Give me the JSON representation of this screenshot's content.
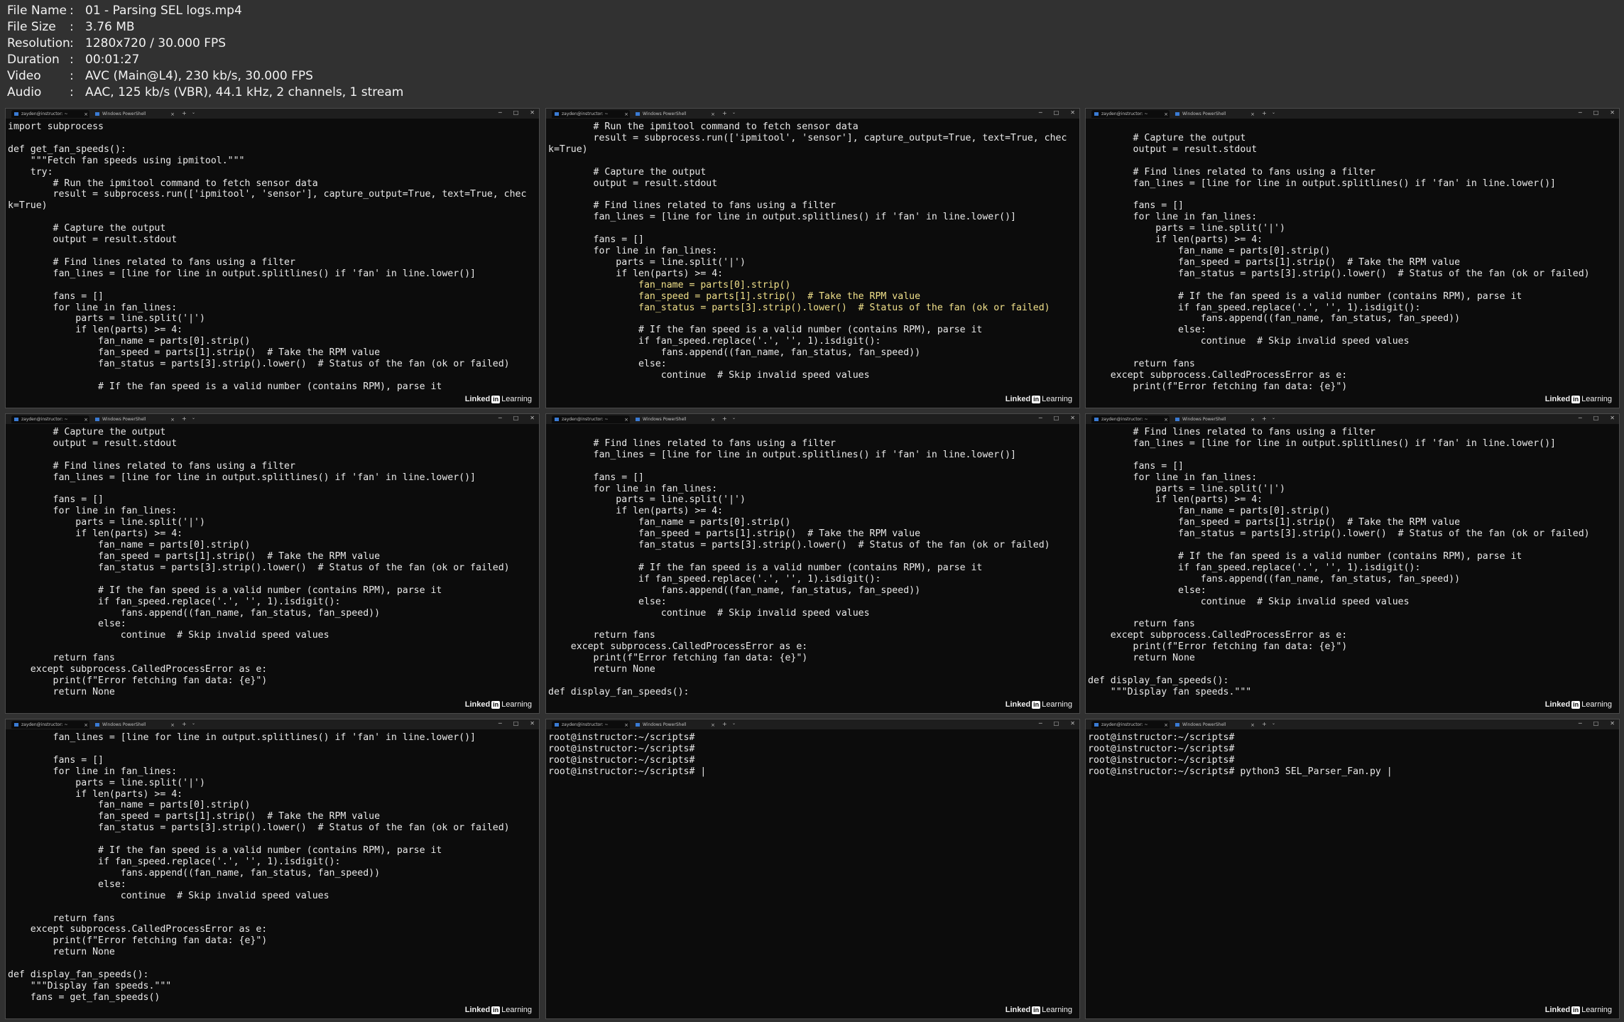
{
  "metadata": [
    {
      "key": "File Name",
      "value": "01 - Parsing SEL logs.mp4"
    },
    {
      "key": "File Size",
      "value": "3.76 MB"
    },
    {
      "key": "Resolution",
      "value": "1280x720 / 30.000 FPS"
    },
    {
      "key": "Duration",
      "value": "00:01:27"
    },
    {
      "key": "Video",
      "value": "AVC (Main@L4), 230 kb/s, 30.000 FPS"
    },
    {
      "key": "Audio",
      "value": "AAC, 125 kb/s (VBR), 44.1 kHz, 2 channels, 1 stream"
    }
  ],
  "terminal": {
    "tab1_label": "zayden@instructor: ~",
    "tab2_label": "Windows PowerShell",
    "close_glyph": "×",
    "new_tab_glyph": "+",
    "dropdown_glyph": "⌄",
    "minimize_glyph": "─",
    "maximize_glyph": "□",
    "window_close_glyph": "✕"
  },
  "watermark": {
    "text1": "Linked",
    "badge": "in",
    "text2": "Learning"
  },
  "frames": [
    {
      "lines": [
        "import subprocess",
        "",
        "def get_fan_speeds():",
        "    \"\"\"Fetch fan speeds using ipmitool.\"\"\"",
        "    try:",
        "        # Run the ipmitool command to fetch sensor data",
        "        result = subprocess.run(['ipmitool', 'sensor'], capture_output=True, text=True, chec",
        "k=True)",
        "",
        "        # Capture the output",
        "        output = result.stdout",
        "",
        "        # Find lines related to fans using a filter",
        "        fan_lines = [line for line in output.splitlines() if 'fan' in line.lower()]",
        "",
        "        fans = []",
        "        for line in fan_lines:",
        "            parts = line.split('|')",
        "            if len(parts) >= 4:",
        "                fan_name = parts[0].strip()",
        "                fan_speed = parts[1].strip()  # Take the RPM value",
        "                fan_status = parts[3].strip().lower()  # Status of the fan (ok or failed)",
        "",
        "                # If the fan speed is a valid number (contains RPM), parse it"
      ]
    },
    {
      "lines": [
        "        # Run the ipmitool command to fetch sensor data",
        "        result = subprocess.run(['ipmitool', 'sensor'], capture_output=True, text=True, chec",
        "k=True)",
        "",
        "        # Capture the output",
        "        output = result.stdout",
        "",
        "        # Find lines related to fans using a filter",
        "        fan_lines = [line for line in output.splitlines() if 'fan' in line.lower()]",
        "",
        "        fans = []",
        "        for line in fan_lines:",
        "            parts = line.split('|')",
        "            if len(parts) >= 4:",
        "                fan_name = parts[0].strip()",
        "                fan_speed = parts[1].strip()  # Take the RPM value",
        "                fan_status = parts[3].strip().lower()  # Status of the fan (ok or failed)",
        "",
        "                # If the fan speed is a valid number (contains RPM), parse it",
        "                if fan_speed.replace('.', '', 1).isdigit():",
        "                    fans.append((fan_name, fan_status, fan_speed))",
        "                else:",
        "                    continue  # Skip invalid speed values"
      ],
      "highlight": [
        14,
        15,
        16
      ]
    },
    {
      "lines": [
        "",
        "        # Capture the output",
        "        output = result.stdout",
        "",
        "        # Find lines related to fans using a filter",
        "        fan_lines = [line for line in output.splitlines() if 'fan' in line.lower()]",
        "",
        "        fans = []",
        "        for line in fan_lines:",
        "            parts = line.split('|')",
        "            if len(parts) >= 4:",
        "                fan_name = parts[0].strip()",
        "                fan_speed = parts[1].strip()  # Take the RPM value",
        "                fan_status = parts[3].strip().lower()  # Status of the fan (ok or failed)",
        "",
        "                # If the fan speed is a valid number (contains RPM), parse it",
        "                if fan_speed.replace('.', '', 1).isdigit():",
        "                    fans.append((fan_name, fan_status, fan_speed))",
        "                else:",
        "                    continue  # Skip invalid speed values",
        "",
        "        return fans",
        "    except subprocess.CalledProcessError as e:",
        "        print(f\"Error fetching fan data: {e}\")"
      ]
    },
    {
      "lines": [
        "        # Capture the output",
        "        output = result.stdout",
        "",
        "        # Find lines related to fans using a filter",
        "        fan_lines = [line for line in output.splitlines() if 'fan' in line.lower()]",
        "",
        "        fans = []",
        "        for line in fan_lines:",
        "            parts = line.split('|')",
        "            if len(parts) >= 4:",
        "                fan_name = parts[0].strip()",
        "                fan_speed = parts[1].strip()  # Take the RPM value",
        "                fan_status = parts[3].strip().lower()  # Status of the fan (ok or failed)",
        "",
        "                # If the fan speed is a valid number (contains RPM), parse it",
        "                if fan_speed.replace('.', '', 1).isdigit():",
        "                    fans.append((fan_name, fan_status, fan_speed))",
        "                else:",
        "                    continue  # Skip invalid speed values",
        "",
        "        return fans",
        "    except subprocess.CalledProcessError as e:",
        "        print(f\"Error fetching fan data: {e}\")",
        "        return None"
      ]
    },
    {
      "lines": [
        "",
        "        # Find lines related to fans using a filter",
        "        fan_lines = [line for line in output.splitlines() if 'fan' in line.lower()]",
        "",
        "        fans = []",
        "        for line in fan_lines:",
        "            parts = line.split('|')",
        "            if len(parts) >= 4:",
        "                fan_name = parts[0].strip()",
        "                fan_speed = parts[1].strip()  # Take the RPM value",
        "                fan_status = parts[3].strip().lower()  # Status of the fan (ok or failed)",
        "",
        "                # If the fan speed is a valid number (contains RPM), parse it",
        "                if fan_speed.replace('.', '', 1).isdigit():",
        "                    fans.append((fan_name, fan_status, fan_speed))",
        "                else:",
        "                    continue  # Skip invalid speed values",
        "",
        "        return fans",
        "    except subprocess.CalledProcessError as e:",
        "        print(f\"Error fetching fan data: {e}\")",
        "        return None",
        "",
        "def display_fan_speeds():"
      ]
    },
    {
      "lines": [
        "        # Find lines related to fans using a filter",
        "        fan_lines = [line for line in output.splitlines() if 'fan' in line.lower()]",
        "",
        "        fans = []",
        "        for line in fan_lines:",
        "            parts = line.split('|')",
        "            if len(parts) >= 4:",
        "                fan_name = parts[0].strip()",
        "                fan_speed = parts[1].strip()  # Take the RPM value",
        "                fan_status = parts[3].strip().lower()  # Status of the fan (ok or failed)",
        "",
        "                # If the fan speed is a valid number (contains RPM), parse it",
        "                if fan_speed.replace('.', '', 1).isdigit():",
        "                    fans.append((fan_name, fan_status, fan_speed))",
        "                else:",
        "                    continue  # Skip invalid speed values",
        "",
        "        return fans",
        "    except subprocess.CalledProcessError as e:",
        "        print(f\"Error fetching fan data: {e}\")",
        "        return None",
        "",
        "def display_fan_speeds():",
        "    \"\"\"Display fan speeds.\"\"\""
      ]
    },
    {
      "lines": [
        "        fan_lines = [line for line in output.splitlines() if 'fan' in line.lower()]",
        "",
        "        fans = []",
        "        for line in fan_lines:",
        "            parts = line.split('|')",
        "            if len(parts) >= 4:",
        "                fan_name = parts[0].strip()",
        "                fan_speed = parts[1].strip()  # Take the RPM value",
        "                fan_status = parts[3].strip().lower()  # Status of the fan (ok or failed)",
        "",
        "                # If the fan speed is a valid number (contains RPM), parse it",
        "                if fan_speed.replace('.', '', 1).isdigit():",
        "                    fans.append((fan_name, fan_status, fan_speed))",
        "                else:",
        "                    continue  # Skip invalid speed values",
        "",
        "        return fans",
        "    except subprocess.CalledProcessError as e:",
        "        print(f\"Error fetching fan data: {e}\")",
        "        return None",
        "",
        "def display_fan_speeds():",
        "    \"\"\"Display fan speeds.\"\"\"",
        "    fans = get_fan_speeds()"
      ]
    },
    {
      "lines": [
        "root@instructor:~/scripts#",
        "root@instructor:~/scripts#",
        "root@instructor:~/scripts#",
        "root@instructor:~/scripts# |"
      ]
    },
    {
      "lines": [
        "root@instructor:~/scripts#",
        "root@instructor:~/scripts#",
        "root@instructor:~/scripts#",
        "root@instructor:~/scripts# python3 SEL_Parser_Fan.py |"
      ]
    }
  ]
}
